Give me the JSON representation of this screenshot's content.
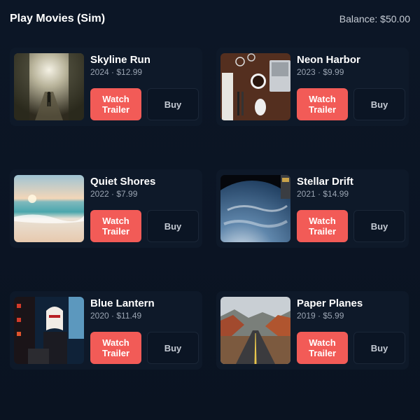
{
  "header": {
    "title": "Play Movies (Sim)",
    "balance": "Balance: $50.00"
  },
  "movies": [
    {
      "title": "Skyline Run",
      "meta": "2024 · $12.99",
      "trailer_label": "Watch Trailer",
      "buy_label": "Buy",
      "thumbnail": "forest-path-runner-image"
    },
    {
      "title": "Neon Harbor",
      "meta": "2023 · $9.99",
      "trailer_label": "Watch Trailer",
      "buy_label": "Buy",
      "thumbnail": "desk-laptop-coffee-image"
    },
    {
      "title": "Quiet Shores",
      "meta": "2022 · $7.99",
      "trailer_label": "Watch Trailer",
      "buy_label": "Buy",
      "thumbnail": "beach-sunset-image"
    },
    {
      "title": "Stellar Drift",
      "meta": "2021 · $14.99",
      "trailer_label": "Watch Trailer",
      "buy_label": "Buy",
      "thumbnail": "earth-from-space-image"
    },
    {
      "title": "Blue Lantern",
      "meta": "2020 · $11.49",
      "trailer_label": "Watch Trailer",
      "buy_label": "Buy",
      "thumbnail": "dj-neon-lights-image"
    },
    {
      "title": "Paper Planes",
      "meta": "2019 · $5.99",
      "trailer_label": "Watch Trailer",
      "buy_label": "Buy",
      "thumbnail": "desert-road-canyon-image"
    }
  ],
  "colors": {
    "background": "#0b1422",
    "card": "#0e1929",
    "accent": "#f25b57",
    "buy_border": "#1b2738"
  }
}
